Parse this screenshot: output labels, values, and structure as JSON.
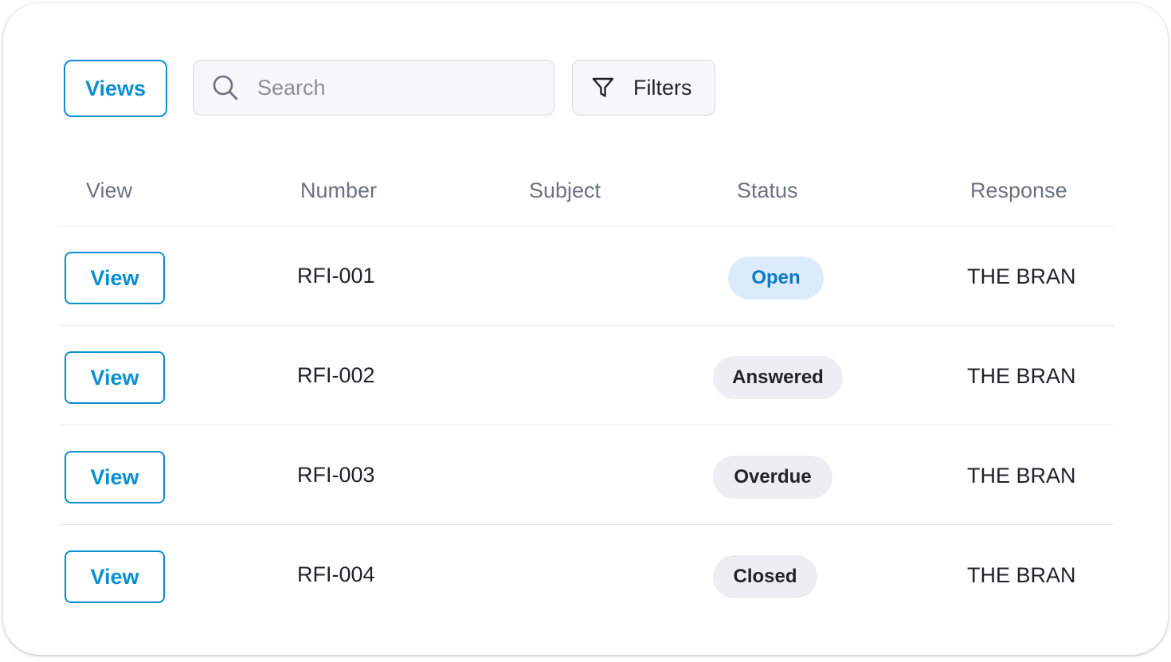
{
  "toolbar": {
    "views_label": "Views",
    "search_placeholder": "Search",
    "filters_label": "Filters"
  },
  "table": {
    "headers": {
      "view": "View",
      "number": "Number",
      "subject": "Subject",
      "status": "Status",
      "response": "Response"
    },
    "rows": [
      {
        "action": "View",
        "number": "RFI-001",
        "subject": "",
        "status": "Open",
        "response": "THE BRAN"
      },
      {
        "action": "View",
        "number": "RFI-002",
        "subject": "",
        "status": "Answered",
        "response": "THE BRAN"
      },
      {
        "action": "View",
        "number": "RFI-003",
        "subject": "",
        "status": "Overdue",
        "response": "THE BRAN"
      },
      {
        "action": "View",
        "number": "RFI-004",
        "subject": "",
        "status": "Closed",
        "response": "THE BRAN"
      }
    ]
  },
  "icons": {
    "search": "search-icon",
    "filter": "filter-icon"
  },
  "colors": {
    "accent": "#0b8fd0",
    "open_badge_bg": "#dcebfb",
    "open_badge_text": "#0b79c7",
    "neutral_badge_bg": "#eceef1"
  }
}
